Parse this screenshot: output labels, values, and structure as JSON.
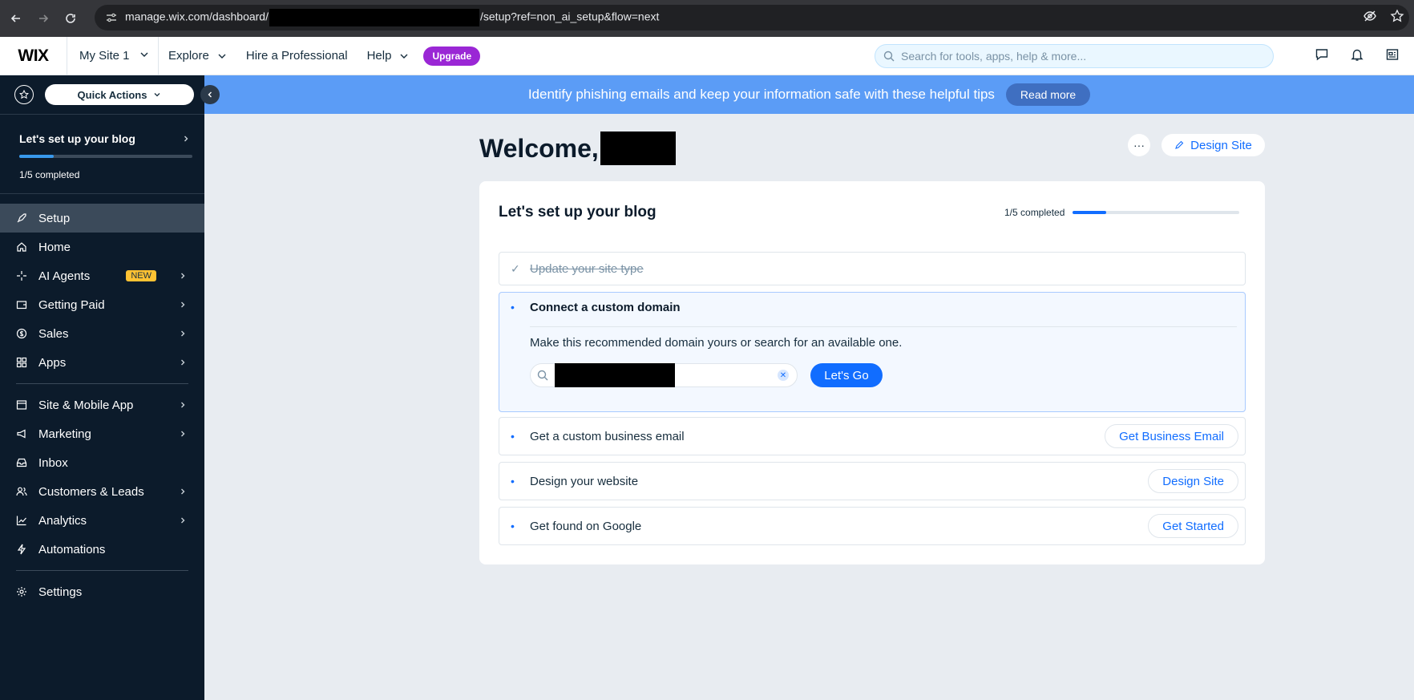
{
  "browser": {
    "url_start": "manage.wix.com/dashboard/",
    "url_end": "/setup?ref=non_ai_setup&flow=next"
  },
  "topbar": {
    "logo": "WIX",
    "site_name": "My Site 1",
    "nav": [
      "Explore",
      "Hire a Professional",
      "Help"
    ],
    "upgrade": "Upgrade",
    "search_placeholder": "Search for tools, apps, help & more..."
  },
  "sidebar": {
    "quick_actions": "Quick Actions",
    "setup_title": "Let's set up your blog",
    "setup_progress": "1/5 completed",
    "setup_fraction": 0.2,
    "items": [
      {
        "label": "Setup",
        "icon": "rocket-icon"
      },
      {
        "label": "Home",
        "icon": "home-icon"
      },
      {
        "label": "AI Agents",
        "icon": "sparkle-icon",
        "badge": "NEW"
      },
      {
        "label": "Getting Paid",
        "icon": "wallet-icon"
      },
      {
        "label": "Sales",
        "icon": "dollar-icon"
      },
      {
        "label": "Apps",
        "icon": "apps-icon"
      },
      {
        "label": "Site & Mobile App",
        "icon": "layout-icon"
      },
      {
        "label": "Marketing",
        "icon": "megaphone-icon"
      },
      {
        "label": "Inbox",
        "icon": "inbox-icon"
      },
      {
        "label": "Customers & Leads",
        "icon": "people-icon"
      },
      {
        "label": "Analytics",
        "icon": "chart-icon"
      },
      {
        "label": "Automations",
        "icon": "bolt-icon"
      },
      {
        "label": "Settings",
        "icon": "gear-icon"
      }
    ]
  },
  "banner": {
    "text": "Identify phishing emails and keep your information safe with these helpful tips",
    "button": "Read more"
  },
  "main": {
    "welcome": "Welcome,",
    "design_site": "Design Site",
    "card": {
      "title": "Let's set up your blog",
      "progress_text": "1/5 completed",
      "progress_fraction": 0.2,
      "steps": {
        "done": "Update your site type",
        "domain": {
          "title": "Connect a custom domain",
          "desc": "Make this recommended domain yours or search for an available one.",
          "button": "Let's Go"
        },
        "email": {
          "label": "Get a custom business email",
          "button": "Get Business Email"
        },
        "design": {
          "label": "Design your website",
          "button": "Design Site"
        },
        "google": {
          "label": "Get found on Google",
          "button": "Get Started"
        }
      }
    }
  },
  "colors": {
    "accent": "#116dff",
    "sidebar_bg": "#0c1b2b",
    "banner_bg": "#5b9cf6",
    "upgrade": "#9a27d5",
    "new_badge": "#ffc233"
  }
}
